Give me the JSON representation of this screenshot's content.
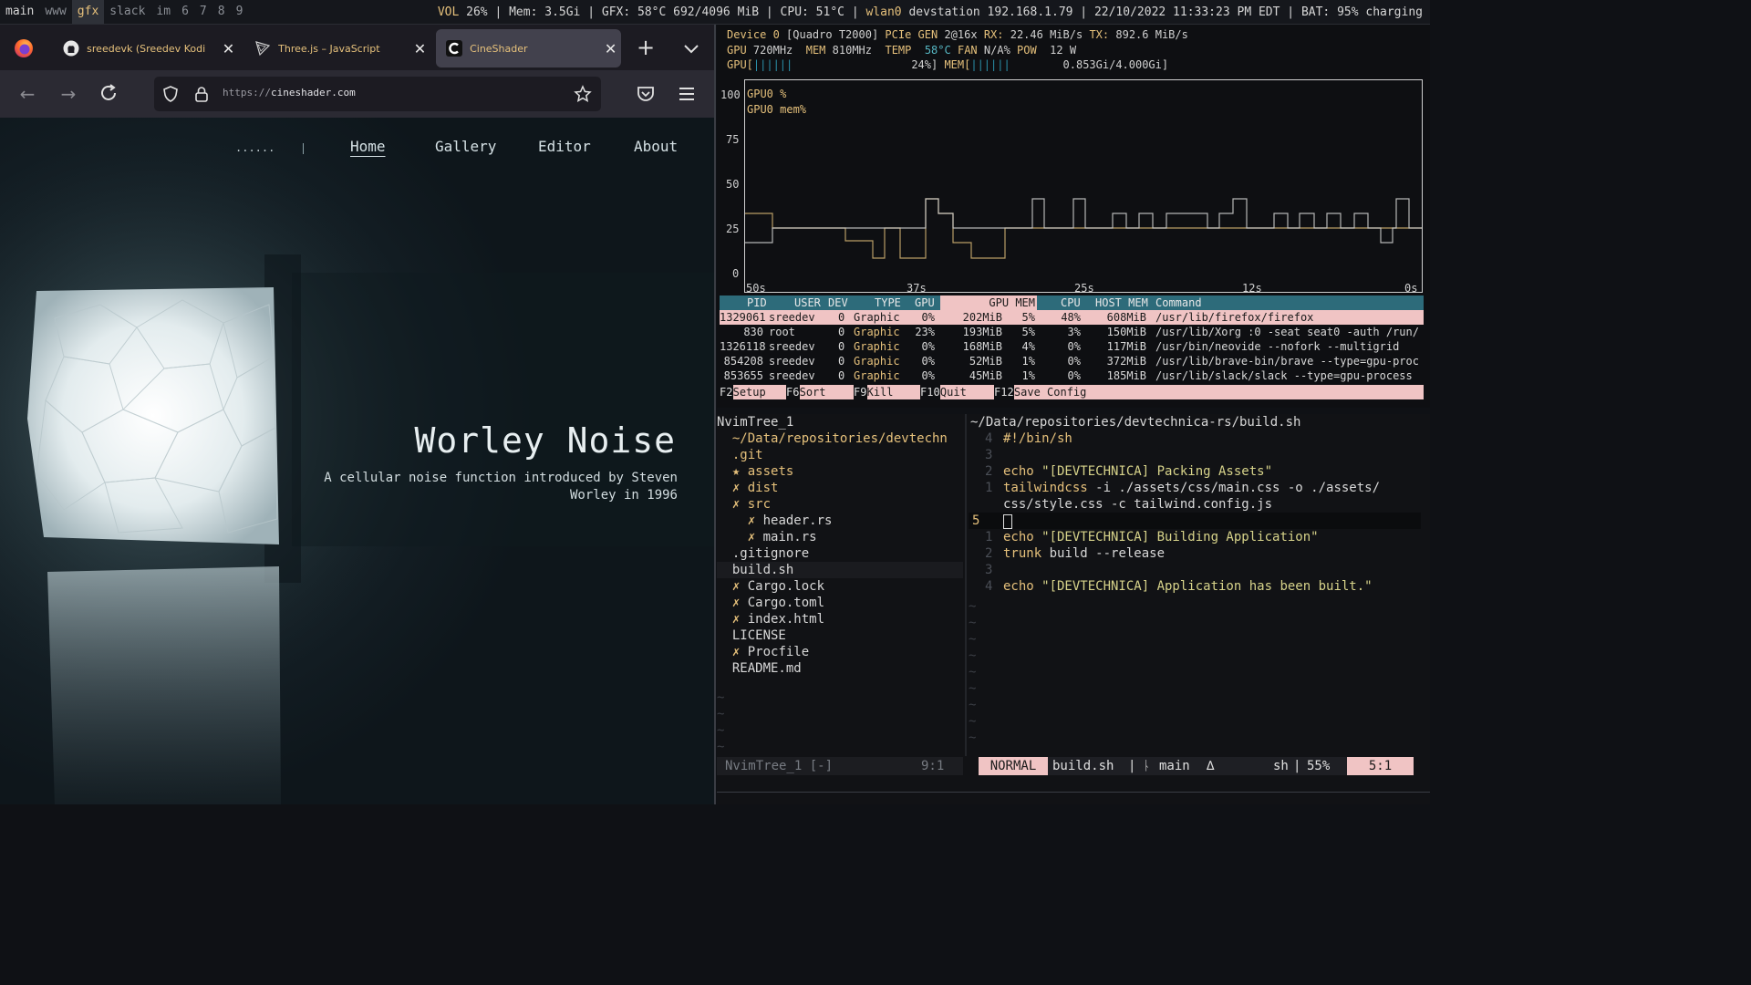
{
  "topbar": {
    "workspaces": [
      "main",
      "www",
      "gfx",
      "slack",
      "im",
      "6",
      "7",
      "8",
      "9"
    ],
    "active_workspace": "gfx",
    "vol_label": "VOL",
    "vol_value": "26%",
    "mem": "Mem: 3.5Gi",
    "gfx": "GFX: 58°C 692/4096 MiB",
    "cpu": "CPU: 51°C",
    "net_iface": "wlan0",
    "net_info": "devstation 192.168.1.79",
    "datetime": "22/10/2022 11:33:23 PM EDT",
    "battery": "BAT: 95% charging"
  },
  "browser": {
    "tabs": [
      {
        "label": "sreedevk (Sreedev Kodi",
        "icon": "github-icon"
      },
      {
        "label": "Three.js – JavaScript",
        "icon": "threejs-icon"
      },
      {
        "label": "CineShader",
        "icon": "cineshader-icon"
      }
    ],
    "url_prefix": "https://",
    "url_host": "cineshader.com"
  },
  "site": {
    "logo": "......",
    "nav": [
      "Home",
      "Gallery",
      "Editor",
      "About"
    ],
    "title": "Worley Noise",
    "subtitle": "A cellular noise function introduced by Steven Worley in 1996"
  },
  "nvtop": {
    "device_line": {
      "device": "Device 0",
      "name": "[Quadro T2000]",
      "pcie_label": "PCIe GEN",
      "pcie_val": "2@16x",
      "rx_label": "RX:",
      "rx_val": "22.46 MiB/s",
      "tx_label": "TX:",
      "tx_val": "892.6 MiB/s"
    },
    "clock_line": {
      "gpu_label": "GPU",
      "gpu_val": "720MHz",
      "mem_label": "MEM",
      "mem_val": "810MHz",
      "temp_label": "TEMP",
      "temp_val": "58°C",
      "fan_label": "FAN",
      "fan_val": "N/A%",
      "pow_label": "POW",
      "pow_val": "12 W"
    },
    "gpu_bar": {
      "label": "GPU[",
      "bars": "||||||",
      "pct": "24%]",
      "fill": 0.24
    },
    "mem_bar": {
      "label": "MEM[",
      "bars": "||||||",
      "val": "0.853Gi/4.000Gi]",
      "fill": 0.21
    },
    "graph_legend": [
      "GPU0 %",
      "GPU0 mem%"
    ],
    "graph_y_ticks": [
      "100",
      "75",
      "50",
      "25",
      "0"
    ],
    "graph_x_ticks": [
      "50s",
      "37s",
      "25s",
      "12s",
      "0s"
    ],
    "table_headers": [
      "PID",
      "USER",
      "DEV",
      "TYPE",
      "GPU",
      "GPU MEM",
      "CPU",
      "HOST MEM",
      "Command"
    ],
    "processes": [
      {
        "pid": "1329061",
        "user": "sreedev",
        "dev": "0",
        "type": "Graphic",
        "gpu": "0%",
        "gmem": "202MiB",
        "gmem_pct": "5%",
        "cpu": "48%",
        "hmem": "608MiB",
        "cmd": "/usr/lib/firefox/firefox"
      },
      {
        "pid": "830",
        "user": "root",
        "dev": "0",
        "type": "Graphic",
        "gpu": "23%",
        "gmem": "193MiB",
        "gmem_pct": "5%",
        "cpu": "3%",
        "hmem": "150MiB",
        "cmd": "/usr/lib/Xorg :0 -seat seat0 -auth /run/"
      },
      {
        "pid": "1326118",
        "user": "sreedev",
        "dev": "0",
        "type": "Graphic",
        "gpu": "0%",
        "gmem": "168MiB",
        "gmem_pct": "4%",
        "cpu": "0%",
        "hmem": "117MiB",
        "cmd": "/usr/bin/neovide --nofork --multigrid"
      },
      {
        "pid": "854208",
        "user": "sreedev",
        "dev": "0",
        "type": "Graphic",
        "gpu": "0%",
        "gmem": "52MiB",
        "gmem_pct": "1%",
        "cpu": "0%",
        "hmem": "372MiB",
        "cmd": "/usr/lib/brave-bin/brave --type=gpu-proc"
      },
      {
        "pid": "853655",
        "user": "sreedev",
        "dev": "0",
        "type": "Graphic",
        "gpu": "0%",
        "gmem": "45MiB",
        "gmem_pct": "1%",
        "cpu": "0%",
        "hmem": "185MiB",
        "cmd": "/usr/lib/slack/slack --type=gpu-process"
      }
    ],
    "fkeys": [
      {
        "key": "F2",
        "label": "Setup"
      },
      {
        "key": "F6",
        "label": "Sort"
      },
      {
        "key": "F9",
        "label": "Kill"
      },
      {
        "key": "F10",
        "label": "Quit"
      },
      {
        "key": "F12",
        "label": "Save Config"
      }
    ]
  },
  "editor": {
    "tree_title": "NvimTree_1",
    "tree": [
      {
        "prefix": "",
        "name": "~/Data/repositories/devtechn",
        "color": "#e5c07b"
      },
      {
        "prefix": "",
        "name": ".git",
        "color": "#e5c07b"
      },
      {
        "prefix": "★",
        "name": "assets",
        "color": "#e5c07b"
      },
      {
        "prefix": "✗",
        "name": "dist",
        "color": "#e5c07b"
      },
      {
        "prefix": "✗",
        "name": "src",
        "color": "#e5c07b"
      },
      {
        "prefix": "  ✗",
        "name": "header.rs",
        "color": "#d8d8d8"
      },
      {
        "prefix": "  ✗",
        "name": "main.rs",
        "color": "#d8d8d8"
      },
      {
        "prefix": "",
        "name": ".gitignore",
        "color": "#d8d8d8"
      },
      {
        "prefix": "",
        "name": "build.sh",
        "color": "#d8d8d8"
      },
      {
        "prefix": "✗",
        "name": "Cargo.lock",
        "color": "#d8d8d8"
      },
      {
        "prefix": "✗",
        "name": "Cargo.toml",
        "color": "#d8d8d8"
      },
      {
        "prefix": "✗",
        "name": "index.html",
        "color": "#d8d8d8"
      },
      {
        "prefix": "",
        "name": "LICENSE",
        "color": "#d8d8d8"
      },
      {
        "prefix": "✗",
        "name": "Procfile",
        "color": "#d8d8d8"
      },
      {
        "prefix": "",
        "name": "README.md",
        "color": "#d8d8d8"
      }
    ],
    "file_path": "~/Data/repositories/devtechnica-rs/build.sh",
    "code": [
      {
        "ln": "4",
        "text": "#!/bin/sh",
        "kind": "shebang"
      },
      {
        "ln": "3",
        "text": "",
        "kind": "blank"
      },
      {
        "ln": "2",
        "text": "echo \"[DEVTECHNICA] Packing Assets\"",
        "kind": "echo"
      },
      {
        "ln": "1",
        "text": "tailwindcss -i ./assets/css/main.css -o ./assets/",
        "kind": "cmd"
      },
      {
        "ln": "",
        "text": "css/style.css -c tailwind.config.js",
        "kind": "cont"
      },
      {
        "ln": "5",
        "text": "",
        "kind": "cursor"
      },
      {
        "ln": "1",
        "text": "echo \"[DEVTECHNICA] Building Application\"",
        "kind": "echo"
      },
      {
        "ln": "2",
        "text": "trunk build --release",
        "kind": "cmd2"
      },
      {
        "ln": "3",
        "text": "",
        "kind": "blank"
      },
      {
        "ln": "4",
        "text": "echo \"[DEVTECHNICA] Application has been built.\"",
        "kind": "echo"
      }
    ],
    "status_left": {
      "name": "NvimTree_1 [-]",
      "pos": "9:1"
    },
    "status_right": {
      "mode": "NORMAL",
      "file": "build.sh",
      "branch_icon": "ᚿ",
      "branch": "main",
      "delta": "∆",
      "ft": "sh",
      "pct": "55%",
      "pos": "5:1"
    }
  },
  "colors": {
    "accent_yellow": "#e5c07b",
    "accent_green": "#98c379",
    "pink": "#f0c4c4",
    "teal": "#2d6b7a"
  }
}
